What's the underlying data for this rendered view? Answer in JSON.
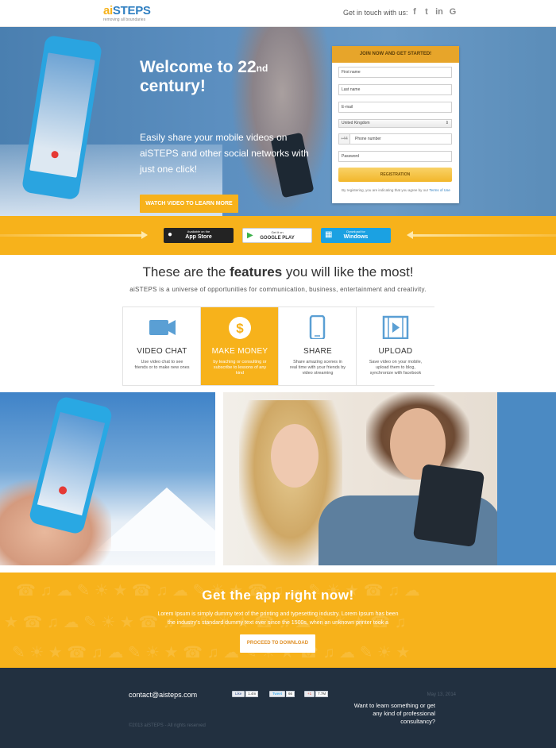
{
  "header": {
    "logo_ai": "ai",
    "logo_steps": "STEPS",
    "logo_tagline": "removing all boundaries",
    "get_in_touch": "Get in touch with us:",
    "social": [
      {
        "name": "facebook-icon",
        "glyph": "f"
      },
      {
        "name": "twitter-icon",
        "glyph": "t"
      },
      {
        "name": "linkedin-icon",
        "glyph": "in"
      },
      {
        "name": "google-plus-icon",
        "glyph": "G"
      }
    ]
  },
  "hero": {
    "title_line1": "Welcome to 22",
    "title_sup": "nd",
    "title_line2": "century!",
    "subtitle": "Easily share your mobile videos on aiSTEPS and other social networks with just one click!",
    "watch_button": "WATCH VIDEO TO LEARN MORE"
  },
  "signup_form": {
    "heading": "JOIN NOW AND GET STARTED!",
    "first_name_placeholder": "First name",
    "last_name_placeholder": "Last name",
    "email_placeholder": "E-mail",
    "country_selected": "United Kingdom",
    "phone_prefix": "+44",
    "phone_placeholder": "Phone number",
    "password_placeholder": "Password",
    "submit": "REGISTRATION",
    "terms_prefix": "By registering, you are indicating that you agree by our",
    "terms_link": "Terms of Use"
  },
  "app_bar": {
    "app_store_small": "Available on the",
    "app_store_big": "App Store",
    "google_play_small": "Get it on",
    "google_play_big": "GOOGLE PLAY",
    "windows_small": "Download for",
    "windows_big": "Windows",
    "colors": {
      "bar": "#f7b21b",
      "app_store": "#232323",
      "google_play": "#ffffff",
      "windows": "#1ba1e2"
    }
  },
  "features": {
    "title_pre": "These are the ",
    "title_bold": "features",
    "title_post": " you will like the most!",
    "description": "aiSTEPS is a universe of opportunities for communication, business, entertainment and creativity.",
    "cards": [
      {
        "icon": "video-camera-icon",
        "title": "VIDEO CHAT",
        "text": "Use video chat to see friends or to make new ones",
        "active": false
      },
      {
        "icon": "dollar-icon",
        "title": "MAKE MONEY",
        "text": "by teaching or consulting or subscribe to lessons of any kind",
        "active": true
      },
      {
        "icon": "smartphone-icon",
        "title": "SHARE",
        "text": "Share amazing scenes in real time with your friends by video streaming",
        "active": false
      },
      {
        "icon": "film-play-icon",
        "title": "UPLOAD",
        "text": "Save video on your mobile, upload them to blog, synchronize with facebook",
        "active": false
      }
    ],
    "accent_color": "#f7b21b",
    "icon_color": "#5a9fd4"
  },
  "cta": {
    "title": "Get the app right now!",
    "text": "Lorem Ipsum is simply dummy text of the printing and typesetting industry. Lorem Ipsum has been the industry's standard dummy text ever since the 1500s, when an unknown printer took a",
    "button": "PROCEED TO DOWNLOAD"
  },
  "footer": {
    "email": "contact@aisteps.com",
    "copyright": "©2013 aiSTEPS - All rights reserved",
    "date": "May 13, 2014",
    "question": "Want to learn something or get any kind of professional consultancy?",
    "share": [
      {
        "label": "Like",
        "count": "1.4m"
      },
      {
        "label": "Tweet",
        "count": "66"
      },
      {
        "label": "+1",
        "count": "7.7M"
      }
    ]
  }
}
